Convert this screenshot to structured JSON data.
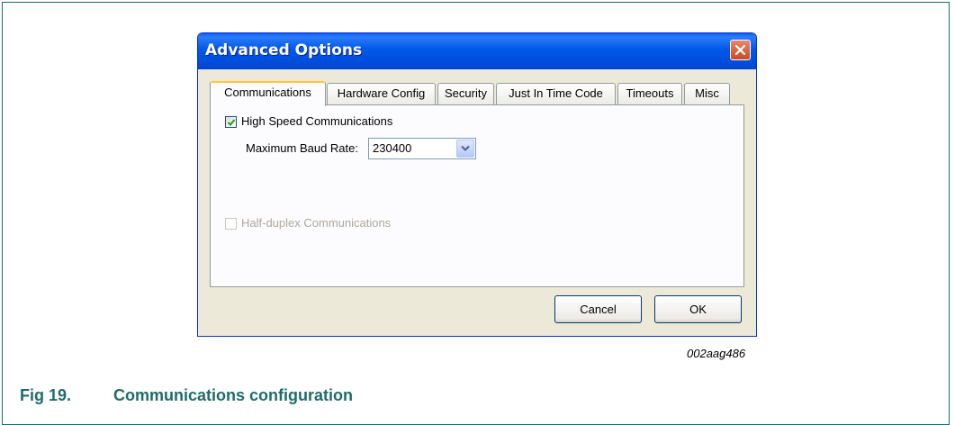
{
  "dialog": {
    "title": "Advanced Options",
    "tabs": [
      {
        "label": "Communications",
        "active": true
      },
      {
        "label": "Hardware Config",
        "active": false
      },
      {
        "label": "Security",
        "active": false
      },
      {
        "label": "Just In Time Code",
        "active": false
      },
      {
        "label": "Timeouts",
        "active": false
      },
      {
        "label": "Misc",
        "active": false
      }
    ],
    "high_speed": {
      "label": "High Speed Communications",
      "checked": true
    },
    "baud_rate": {
      "label": "Maximum Baud Rate:",
      "value": "230400"
    },
    "half_duplex": {
      "label": "Half-duplex Communications",
      "checked": false,
      "disabled": true
    },
    "buttons": {
      "cancel": "Cancel",
      "ok": "OK"
    }
  },
  "figure": {
    "code": "002aag486",
    "number": "Fig 19.",
    "title": "Communications configuration"
  },
  "colors": {
    "titlebar": "#0054e3",
    "caption": "#1f6b6b",
    "active_tab_accent": "#ffc83c",
    "checkmark": "#21a121"
  },
  "icons": {
    "close": "close-icon",
    "check": "checkmark-icon",
    "dropdown": "chevron-down-icon"
  }
}
